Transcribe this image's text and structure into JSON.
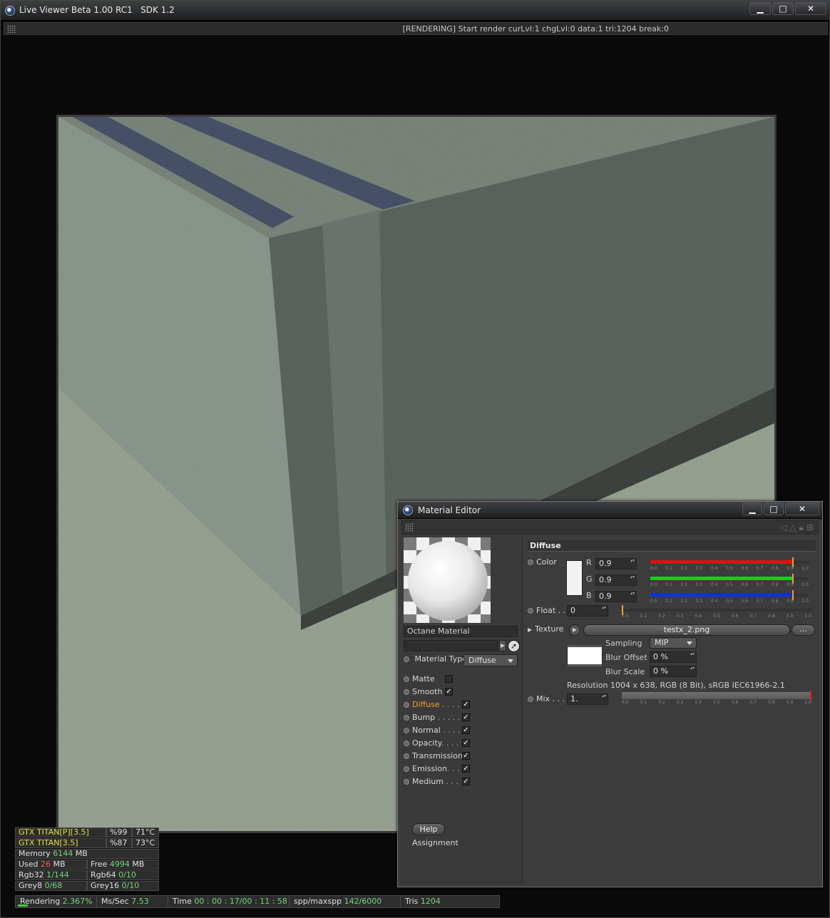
{
  "main_window": {
    "title": "Live Viewer Beta 1.00 RC1   SDK 1.2",
    "render_status": "[RENDERING] Start render curLvl:1 chgLvl:0 data:1 tri:1204 break:0",
    "buttons": {
      "minimize": "▁",
      "maximize": "□",
      "close": "✕"
    }
  },
  "stats": {
    "gpus": [
      {
        "name": "GTX TITAN[P][3.5]",
        "load": "%99",
        "temp": "71°C"
      },
      {
        "name": "GTX TITAN[3.5]",
        "load": "%87",
        "temp": "73°C"
      }
    ],
    "memory": {
      "label": "Memory",
      "value": "6144",
      "unit": "MB"
    },
    "used": {
      "label": "Used",
      "value": "26",
      "unit": "MB"
    },
    "free": {
      "label": "Free",
      "value": "4994",
      "unit": "MB"
    },
    "rgb32": {
      "label": "Rgb32",
      "value": "1/144"
    },
    "rgb64": {
      "label": "Rgb64",
      "value": "0/10"
    },
    "grey8": {
      "label": "Grey8",
      "value": "0/68"
    },
    "grey16": {
      "label": "Grey16",
      "value": "0/10"
    }
  },
  "status_bar": {
    "rendering_label": "Rendering",
    "rendering_value": "2.367%",
    "mssec_label": "Ms/Sec",
    "mssec_value": "7.53",
    "time_label": "Time",
    "time_value": "00 : 00 : 17/00 : 11 : 58",
    "spp_label": "spp/maxspp",
    "spp_value": "142/6000",
    "tris_label": "Tris",
    "tris_value": "1204"
  },
  "material_editor": {
    "title": "Material Editor",
    "buttons": {
      "minimize": "▁",
      "maximize": "□",
      "close": "✕"
    },
    "material_name": "Octane Material",
    "material_type_label": "Material Type",
    "material_type_value": "Diffuse",
    "channels": [
      {
        "label": "Matte",
        "dots": "",
        "checked": false
      },
      {
        "label": "Smooth",
        "dots": "",
        "checked": true
      },
      {
        "label": "Diffuse",
        "dots": " . . . . .",
        "checked": true
      },
      {
        "label": "Bump",
        "dots": " . . . . . .",
        "checked": true
      },
      {
        "label": "Normal",
        "dots": " . . . . .",
        "checked": true
      },
      {
        "label": "Opacity",
        "dots": ". . . . .",
        "checked": true
      },
      {
        "label": "Transmission",
        "dots": "",
        "checked": true
      },
      {
        "label": "Emission",
        "dots": ". . . .",
        "checked": true
      },
      {
        "label": "Medium",
        "dots": " . . . .",
        "checked": true
      }
    ],
    "help_label": "Help",
    "assignment_label": "Assignment",
    "diffuse": {
      "section_title": "Diffuse",
      "color_label": "Color",
      "r_label": "R",
      "r_value": "0.9",
      "g_label": "G",
      "g_value": "0.9",
      "b_label": "B",
      "b_value": "0.9",
      "float_label": "Float . .",
      "float_value": "0",
      "texture_label": "Texture",
      "texture_file": "testx_2.png",
      "texture_more": "...",
      "sampling_label": "Sampling",
      "sampling_value": "MIP",
      "blur_offset_label": "Blur Offset",
      "blur_offset_value": "0 %",
      "blur_scale_label": "Blur Scale",
      "blur_scale_value": "0 %",
      "resolution_text": "Resolution 1004 x 638, RGB (8 Bit), sRGB IEC61966-2.1",
      "mix_label": "Mix . . .",
      "mix_value": "1.",
      "slider_ticks": [
        "0.0",
        "0.1",
        "0.2",
        "0.3",
        "0.4",
        "0.5",
        "0.6",
        "0.7",
        "0.8",
        "0.9",
        "1.0"
      ],
      "colors": {
        "r": "#e01010",
        "g": "#10d020",
        "b": "#1030e0"
      },
      "rgb_levels": {
        "r": 0.9,
        "g": 0.9,
        "b": 0.9
      },
      "float_level": 0
    }
  }
}
